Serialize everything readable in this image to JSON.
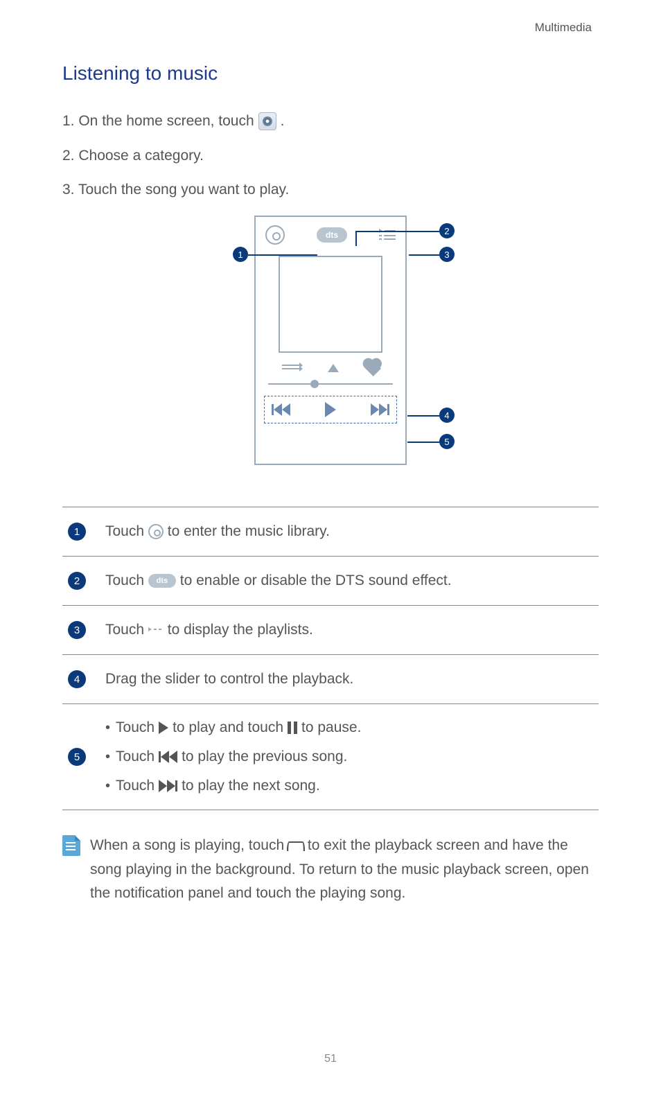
{
  "header": "Multimedia",
  "title": "Listening to music",
  "steps": {
    "s1a": "1. On the home screen, touch",
    "s1b": ".",
    "s2": "2. Choose a category.",
    "s3": "3. Touch the song you want to play."
  },
  "diagram_labels": {
    "c1": "1",
    "c2": "2",
    "c3": "3",
    "c4": "4",
    "c5": "5"
  },
  "dts_text": "dts",
  "table": {
    "r1": {
      "num": "1",
      "a": "Touch",
      "b": "to enter the music library."
    },
    "r2": {
      "num": "2",
      "a": "Touch",
      "b": "to enable or disable the DTS sound effect."
    },
    "r3": {
      "num": "3",
      "a": "Touch",
      "b": "to display the playlists."
    },
    "r4": {
      "num": "4",
      "text": "Drag the slider to control the playback."
    },
    "r5": {
      "num": "5",
      "l1a": "Touch",
      "l1b": "to play and touch",
      "l1c": "to pause.",
      "l2a": "Touch",
      "l2b": "to play the previous song.",
      "l3a": "Touch",
      "l3b": "to play the next song."
    }
  },
  "note": {
    "a": "When a song is playing, touch",
    "b": "to exit the playback screen and have the song playing in the background. To return to the music playback screen, open the notification panel and touch the playing song."
  },
  "page_number": "51"
}
